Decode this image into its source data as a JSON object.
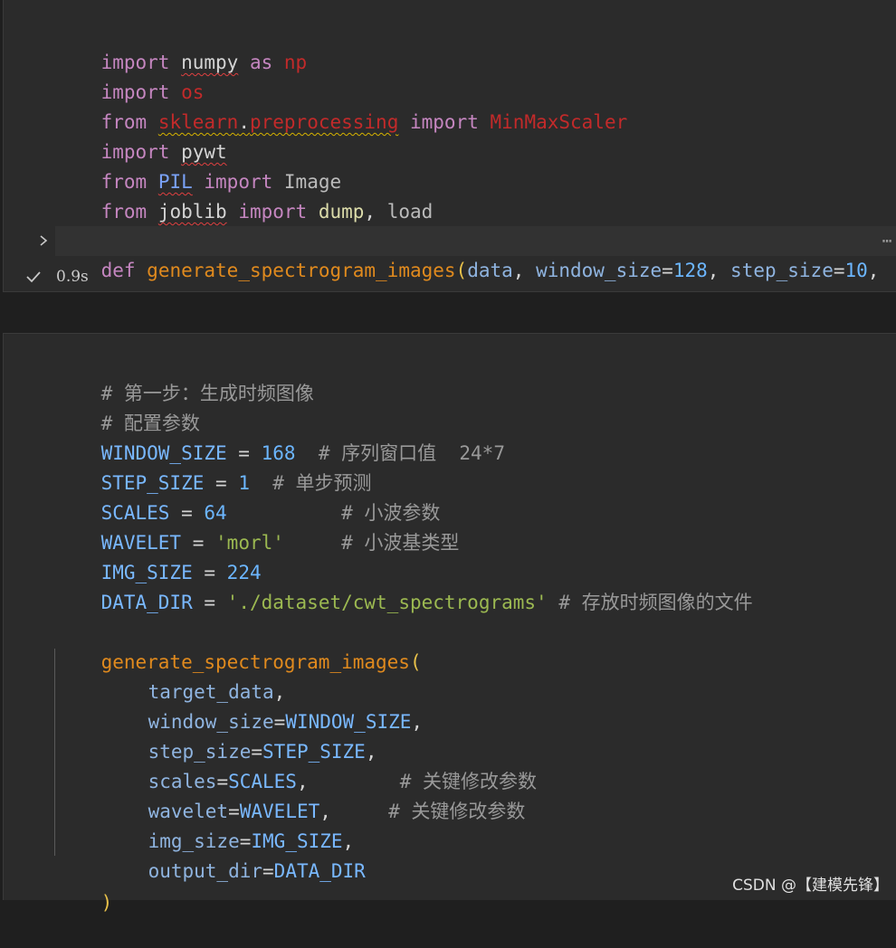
{
  "cell1": {
    "lines": [
      {
        "a": "import",
        "b": " ",
        "c": "numpy",
        "d": " as ",
        "e": "np"
      },
      {
        "a": "import",
        "b": " ",
        "c": "os"
      },
      {
        "a": "from",
        "b": " ",
        "c": "sklearn",
        "d": ".",
        "e": "preprocessing",
        "f": " import ",
        "g": "MinMaxScaler"
      },
      {
        "a": "import",
        "b": " ",
        "c": "pywt"
      },
      {
        "a": "from",
        "b": " ",
        "c": "PIL",
        "d": " import ",
        "e": "Image"
      },
      {
        "a": "from",
        "b": " ",
        "c": "joblib",
        "d": " import ",
        "e": "dump",
        "f": ", ",
        "g": "load"
      }
    ],
    "def_line": {
      "kw": "def",
      "name": "generate_spectrogram_images",
      "open": "(",
      "p1": "data",
      "sep1": ", ",
      "p2": "window_size",
      "eq2": "=",
      "v2": "128",
      "sep2": ", ",
      "p3": "step_size",
      "eq3": "=",
      "v3": "10",
      "sep3": ", "
    },
    "ellipsis": "⋯",
    "exec_time": "0.9s"
  },
  "cell2": {
    "comment1": "# 第一步：生成时频图像",
    "comment2": "# 配置参数",
    "window_size": {
      "name": "WINDOW_SIZE",
      "op": " = ",
      "value": "168",
      "comment": "  # 序列窗口值  24*7"
    },
    "step_size": {
      "name": "STEP_SIZE",
      "op": " = ",
      "value": "1",
      "comment": "  # 单步预测"
    },
    "scales": {
      "name": "SCALES",
      "op": " = ",
      "value": "64",
      "comment": "          # 小波参数"
    },
    "wavelet": {
      "name": "WAVELET",
      "op": " = ",
      "value": "'morl'",
      "comment": "     # 小波基类型"
    },
    "img_size": {
      "name": "IMG_SIZE",
      "op": " = ",
      "value": "224"
    },
    "data_dir": {
      "name": "DATA_DIR",
      "op": " = ",
      "value": "'./dataset/cwt_spectrograms'",
      "comment": " # 存放时频图像的文件"
    },
    "call": {
      "fn": "generate_spectrogram_images",
      "open": "(",
      "close": ")",
      "args": [
        {
          "key": "target_data",
          "eq": "",
          "val": "",
          "end": ",",
          "comment": ""
        },
        {
          "key": "window_size",
          "eq": "=",
          "val": "WINDOW_SIZE",
          "end": ",",
          "comment": ""
        },
        {
          "key": "step_size",
          "eq": "=",
          "val": "STEP_SIZE",
          "end": ",",
          "comment": ""
        },
        {
          "key": "scales",
          "eq": "=",
          "val": "SCALES",
          "end": ",",
          "comment": "        # 关键修改参数"
        },
        {
          "key": "wavelet",
          "eq": "=",
          "val": "WAVELET",
          "end": ",",
          "comment": "     # 关键修改参数"
        },
        {
          "key": "img_size",
          "eq": "=",
          "val": "IMG_SIZE",
          "end": ",",
          "comment": ""
        },
        {
          "key": "output_dir",
          "eq": "=",
          "val": "DATA_DIR",
          "end": "",
          "comment": ""
        }
      ]
    }
  },
  "watermark": "CSDN @【建模先锋】"
}
